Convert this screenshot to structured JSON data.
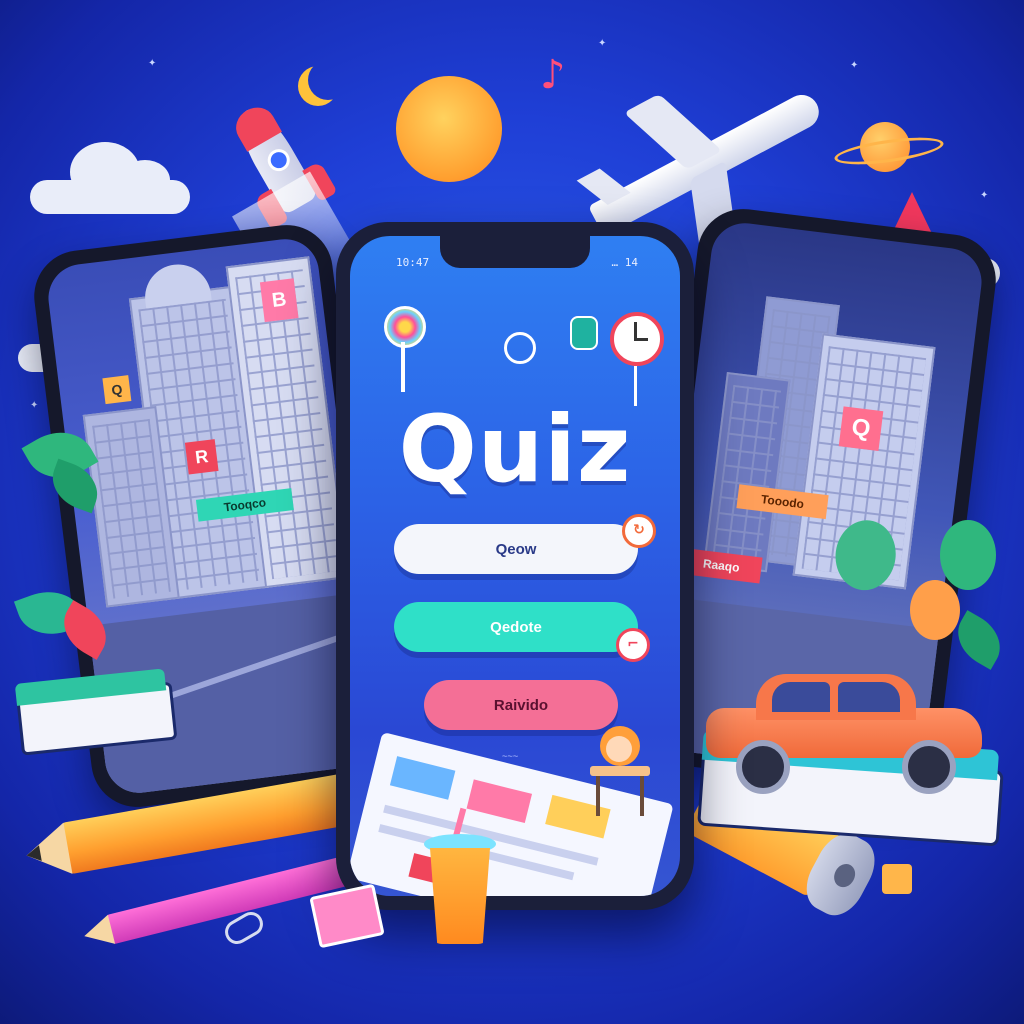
{
  "screen": {
    "status_left": "10:47",
    "status_right": "… 14",
    "title": "Quiz",
    "answers": [
      {
        "label": "Qeow"
      },
      {
        "label": "Qedote"
      },
      {
        "label": "Raivido"
      }
    ],
    "small_caption": "Qeow"
  },
  "left_phone": {
    "signs": [
      "R",
      "Q",
      "B",
      "Tooqco"
    ]
  },
  "right_phone": {
    "signs": [
      "Q",
      "Tooodo",
      "Raaqo"
    ]
  },
  "colors": {
    "background": "#1f3fd6",
    "quiz_screen_top": "#2f7ff2",
    "answer_white": "#f4f6fb",
    "answer_teal": "#2fe0c8",
    "answer_pink": "#f46f96",
    "sun": "#ffb238",
    "pencil_orange": "#ff9f2f",
    "pencil_pink": "#e04fc8"
  },
  "icons": [
    "rocket-icon",
    "airplane-icon",
    "sun-icon",
    "planet-icon",
    "moon-icon",
    "clock-icon",
    "music-note-icon",
    "paperclip-icon",
    "pencil-icon",
    "book-icon",
    "car-icon",
    "cup-icon"
  ]
}
